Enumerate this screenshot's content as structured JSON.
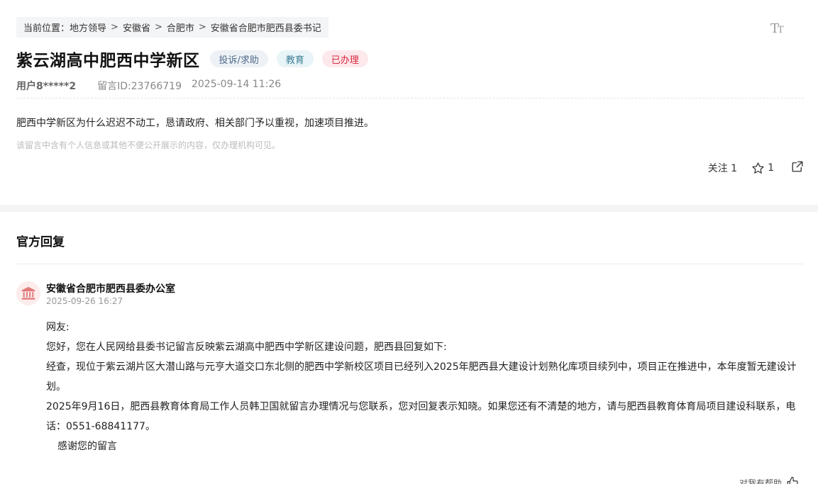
{
  "breadcrumb": {
    "prefix": "当前位置：",
    "items": [
      "地方领导",
      "安徽省",
      "合肥市",
      "安徽省合肥市肥西县委书记"
    ],
    "separator": ">"
  },
  "font_toggle_icon": "font-size-icon",
  "font_toggle_big": "T",
  "font_toggle_small": "T",
  "message": {
    "title": "紫云湖高中肥西中学新区",
    "tags": {
      "type": "投诉/求助",
      "category": "教育",
      "status": "已办理"
    },
    "user": "用户8*****2",
    "message_id": "留言ID:23766719",
    "time": "2025-09-14 11:26",
    "content": "肥西中学新区为什么迟迟不动工，恳请政府、相关部门予以重视，加速项目推进。",
    "notice": "该留言中含有个人信息或其他不便公开展示的内容，仅办理机构可见。"
  },
  "actions": {
    "follow_label": "关注 1",
    "star_count": "1",
    "star_icon": "star-icon",
    "share_icon": "share-icon"
  },
  "reply": {
    "heading": "官方回复",
    "org_name": "安徽省合肥市肥西县委办公室",
    "org_icon": "government-building-icon",
    "time": "2025-09-26 16:27",
    "lines": [
      "网友:",
      "您好，您在人民网给县委书记留言反映紫云湖高中肥西中学新区建设问题，肥西县回复如下:",
      "经查，现位于紫云湖片区大潜山路与元亨大道交口东北侧的肥西中学新校区项目已经列入2025年肥西县大建设计划熟化库项目续列中，项目正在推进中，本年度暂无建设计划。",
      "2025年9月16日，肥西县教育体育局工作人员韩卫国就留言办理情况与您联系，您对回复表示知晓。如果您还有不清楚的地方，请与肥西县教育体育局项目建设科联系，电话：0551-68841177。",
      "感谢您的留言"
    ],
    "helpful_label": "对我有帮助",
    "helpful_icon": "thumbs-up-icon"
  }
}
